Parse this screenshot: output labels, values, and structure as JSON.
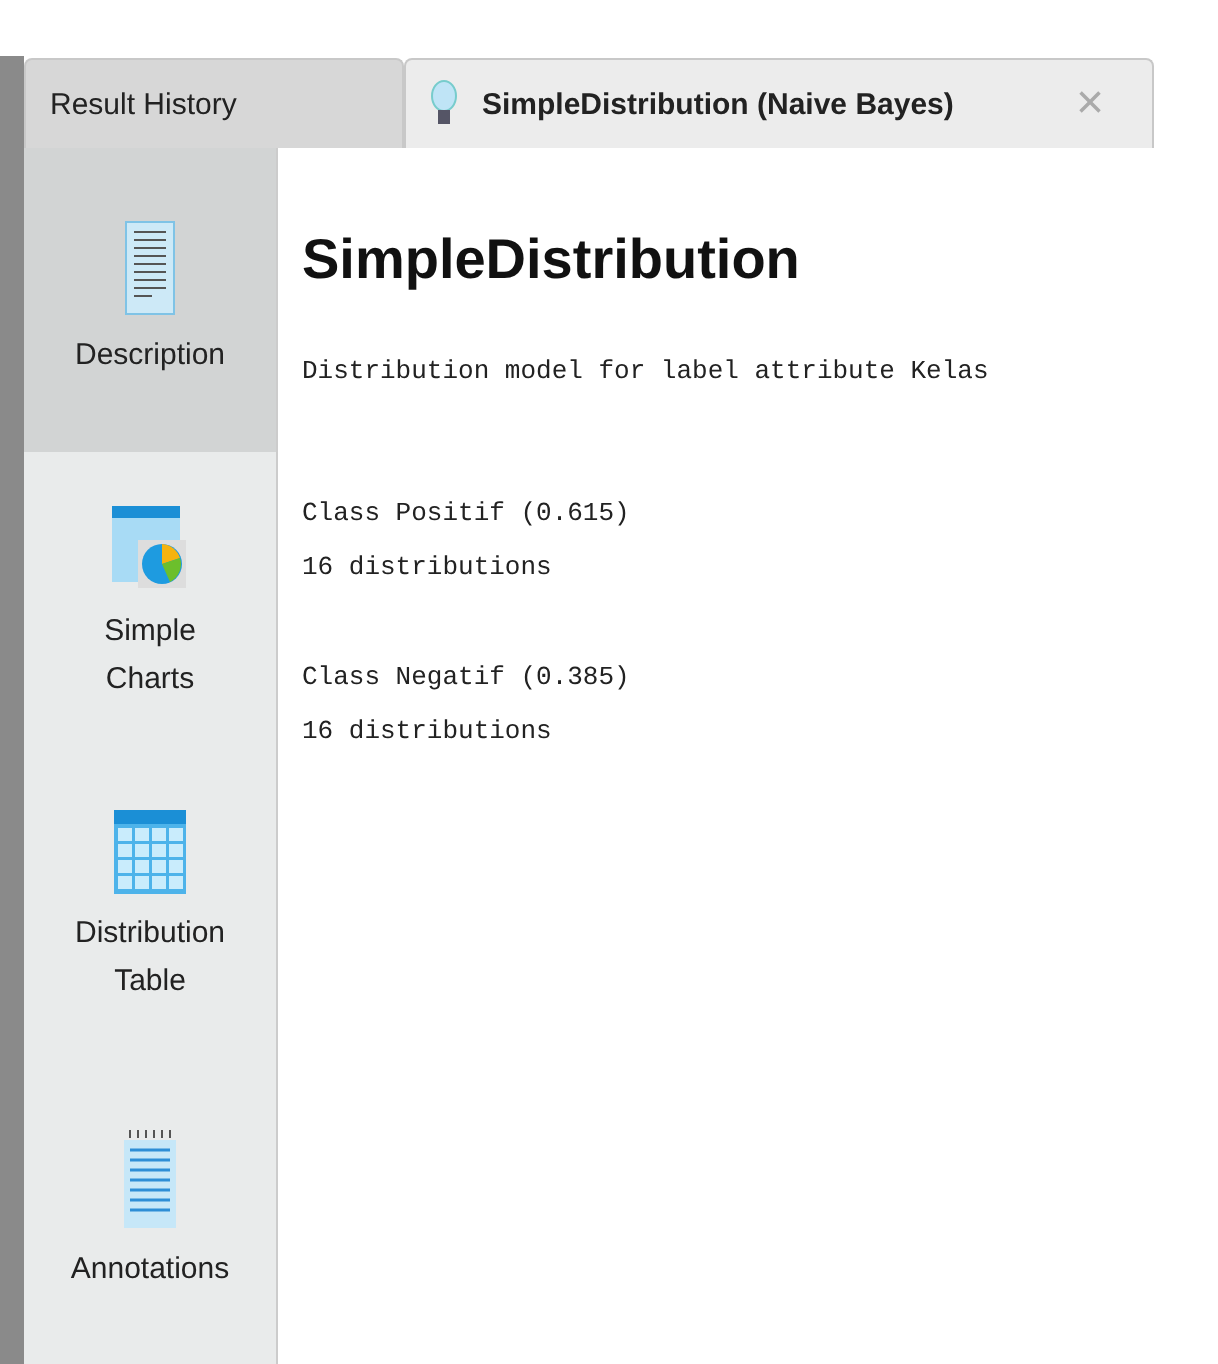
{
  "tabs": [
    {
      "label": "Result History",
      "selected": false
    },
    {
      "label": "SimpleDistribution (Naive Bayes)",
      "selected": true,
      "close": "×"
    }
  ],
  "sidebar": {
    "items": [
      {
        "kind": "document",
        "label": "Description",
        "selected": true
      },
      {
        "kind": "charts",
        "label": "Simple Charts",
        "selected": false
      },
      {
        "kind": "table",
        "label": "Distribution Table",
        "selected": false
      },
      {
        "kind": "notes",
        "label": "Annotations",
        "selected": false
      }
    ]
  },
  "content": {
    "title": "SimpleDistribution",
    "subtitle": "Distribution model for label attribute Kelas",
    "classes": [
      {
        "name": "Class Positif (0.615)",
        "detail": "16 distributions"
      },
      {
        "name": "Class Negatif (0.385)",
        "detail": "16 distributions"
      }
    ]
  }
}
